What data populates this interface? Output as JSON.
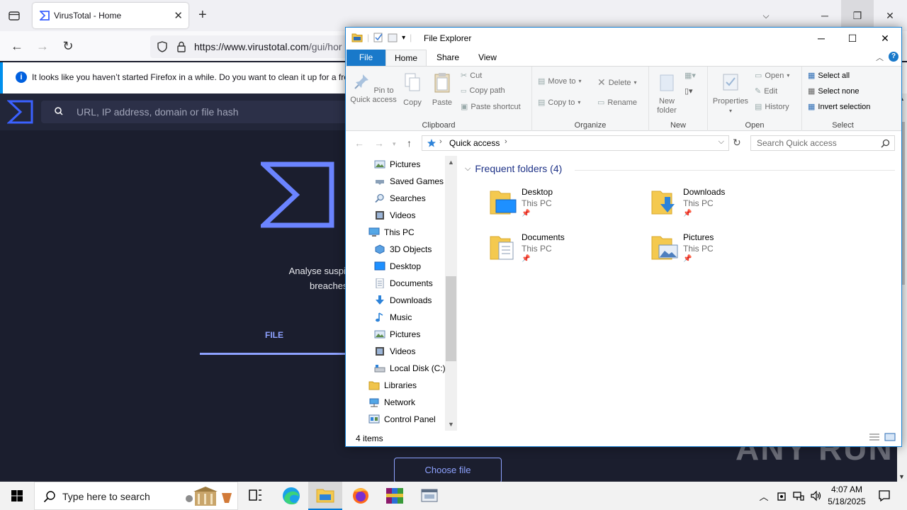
{
  "firefox": {
    "tab_title": "VirusTotal - Home",
    "url_domain": "https://www.virustotal.com",
    "url_path": "/gui/hor",
    "notification": "It looks like you haven’t started Firefox in a while. Do you want to clean it up for a fre"
  },
  "virustotal": {
    "search_placeholder": "URL, IP address, domain or file hash",
    "tagline_1": "Analyse suspi",
    "tagline_2": "breaches",
    "tab_file": "FILE",
    "choose_file": "Choose file"
  },
  "explorer": {
    "title": "File Explorer",
    "ribbon_tabs": [
      "File",
      "Home",
      "Share",
      "View"
    ],
    "clipboard": {
      "pin": "Pin to Quick access",
      "copy": "Copy",
      "paste": "Paste",
      "cut": "Cut",
      "copy_path": "Copy path",
      "paste_shortcut": "Paste shortcut",
      "label": "Clipboard"
    },
    "organize": {
      "move_to": "Move to",
      "copy_to": "Copy to",
      "delete": "Delete",
      "rename": "Rename",
      "label": "Organize"
    },
    "new": {
      "new_folder": "New folder",
      "label": "New"
    },
    "open": {
      "properties": "Properties",
      "open": "Open",
      "edit": "Edit",
      "history": "History",
      "label": "Open"
    },
    "select": {
      "select_all": "Select all",
      "select_none": "Select none",
      "invert": "Invert selection",
      "label": "Select"
    },
    "address": "Quick access",
    "search_placeholder": "Search Quick access",
    "nav_items": [
      "Pictures",
      "Saved Games",
      "Searches",
      "Videos",
      "This PC",
      "3D Objects",
      "Desktop",
      "Documents",
      "Downloads",
      "Music",
      "Pictures",
      "Videos",
      "Local Disk (C:)",
      "Libraries",
      "Network",
      "Control Panel"
    ],
    "section_header": "Frequent folders (4)",
    "folders": [
      {
        "name": "Desktop",
        "location": "This PC"
      },
      {
        "name": "Downloads",
        "location": "This PC"
      },
      {
        "name": "Documents",
        "location": "This PC"
      },
      {
        "name": "Pictures",
        "location": "This PC"
      }
    ],
    "status": "4 items"
  },
  "taskbar": {
    "search_placeholder": "Type here to search",
    "time": "4:07 AM",
    "date": "5/18/2025"
  },
  "watermark": "ANY RUN"
}
